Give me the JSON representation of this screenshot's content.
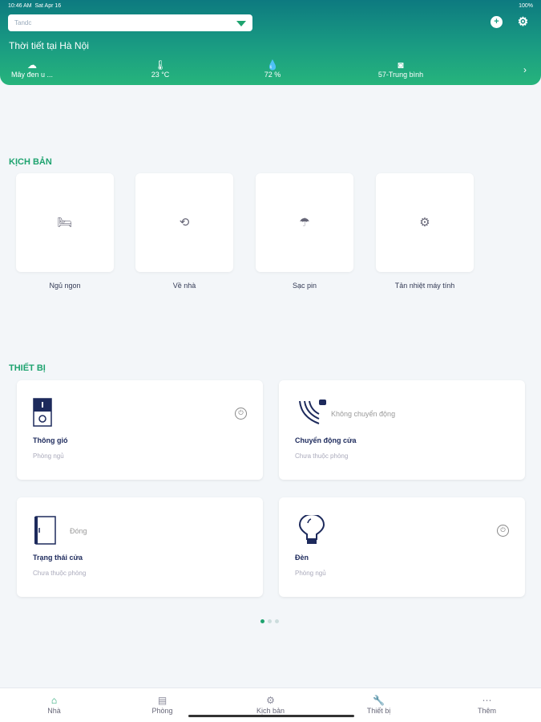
{
  "status": {
    "time": "10:46 AM",
    "date": "Sat Apr 16",
    "battery": "100%"
  },
  "header": {
    "home": "Tandc",
    "add_icon": "+",
    "settings_icon": "⚙",
    "weather_title": "Thời tiết tại Hà Nội",
    "weather": [
      {
        "icon": "☁",
        "value": "Mây đen u ..."
      },
      {
        "icon": "🌡",
        "value": "23 °C"
      },
      {
        "icon": "💧",
        "value": "72 %"
      },
      {
        "icon": "◙",
        "value": "57-Trung bình"
      }
    ]
  },
  "scenes": {
    "title": "KỊCH BẢN",
    "items": [
      {
        "label": "Ngủ ngon",
        "icon": "🛏"
      },
      {
        "label": "Về nhà",
        "icon": "⟲"
      },
      {
        "label": "Sạc pin",
        "icon": "☂"
      },
      {
        "label": "Tản nhiệt máy tính",
        "icon": "⚙"
      }
    ]
  },
  "devices": {
    "title": "THIẾT BỊ",
    "items": [
      {
        "name": "Thông gió",
        "room": "Phòng ngủ",
        "state": ""
      },
      {
        "name": "Chuyển động cửa",
        "room": "Chưa thuộc phòng",
        "state": "Không chuyển động"
      },
      {
        "name": "Trạng thái cửa",
        "room": "Chưa thuộc phòng",
        "state": "Đóng"
      },
      {
        "name": "Đèn",
        "room": "Phòng ngủ",
        "state": ""
      }
    ]
  },
  "pagination": {
    "current": 1,
    "total": 3
  },
  "nav": [
    {
      "label": "Nhà",
      "icon": "⌂"
    },
    {
      "label": "Phòng",
      "icon": "▤"
    },
    {
      "label": "Kịch bản",
      "icon": "⚙"
    },
    {
      "label": "Thiết bị",
      "icon": "🔧"
    },
    {
      "label": "Thêm",
      "icon": "⋯"
    }
  ]
}
